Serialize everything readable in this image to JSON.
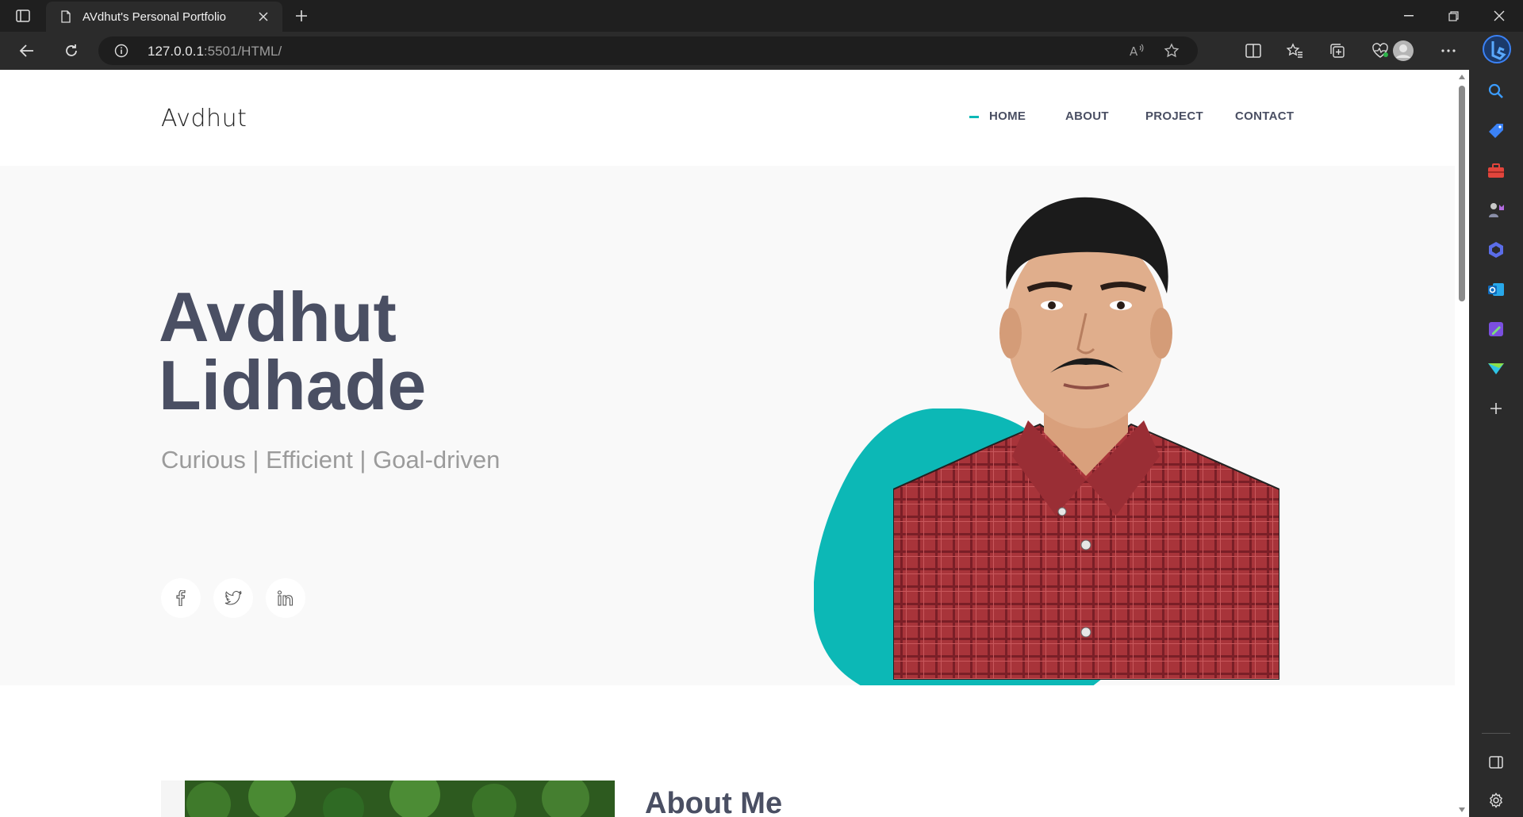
{
  "browser": {
    "tab_title": "AVdhut's Personal Portfolio",
    "url_host": "127.0.0.1",
    "url_rest": ":5501/HTML/"
  },
  "site": {
    "logo": "Avdhut",
    "nav": [
      {
        "label": "HOME",
        "active": true
      },
      {
        "label": "ABOUT",
        "active": false
      },
      {
        "label": "PROJECT",
        "active": false
      },
      {
        "label": "CONTACT",
        "active": false
      }
    ],
    "hero": {
      "first_name": "Avdhut",
      "last_name": "Lidhade",
      "tagline": "Curious | Efficient | Goal-driven",
      "social": [
        "facebook-icon",
        "twitter-icon",
        "linkedin-icon"
      ]
    },
    "about": {
      "title": "About Me"
    }
  },
  "colors": {
    "accent": "#0cb8b6",
    "heading": "#4a4f63",
    "tagline": "#9b9b9b",
    "shirt": "#a8343a"
  }
}
